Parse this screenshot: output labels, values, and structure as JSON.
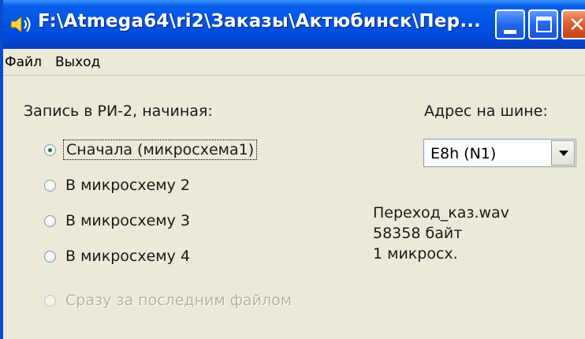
{
  "window": {
    "title": "F:\\Atmega64\\ri2\\Заказы\\Актюбинск\\Пер...",
    "title_icon": "speaker-icon",
    "controls": {
      "minimize_icon": "minimize-icon",
      "maximize_icon": "maximize-icon",
      "close_glyph": "✕"
    },
    "colors": {
      "titlebar": "#0054e3",
      "close": "#e15f2c",
      "face": "#ece9d8"
    }
  },
  "menu": {
    "items": [
      {
        "label": "Файл"
      },
      {
        "label": "Выход"
      }
    ]
  },
  "write_group": {
    "label": "Запись в РИ-2, начиная:",
    "options": [
      {
        "label": "Сначала (микросхема1)",
        "checked": true,
        "enabled": true
      },
      {
        "label": "В микросхему 2",
        "checked": false,
        "enabled": true
      },
      {
        "label": "В микросхему 3",
        "checked": false,
        "enabled": true
      },
      {
        "label": "В микросхему 4",
        "checked": false,
        "enabled": true
      },
      {
        "label": "Сразу за последним файлом",
        "checked": false,
        "enabled": false
      }
    ]
  },
  "address": {
    "label": "Адрес на шине:",
    "selected": "E8h (N1)"
  },
  "file_info": {
    "name": "Переход_каз.wav",
    "size": "58358 байт",
    "chips": "1 микросх."
  }
}
